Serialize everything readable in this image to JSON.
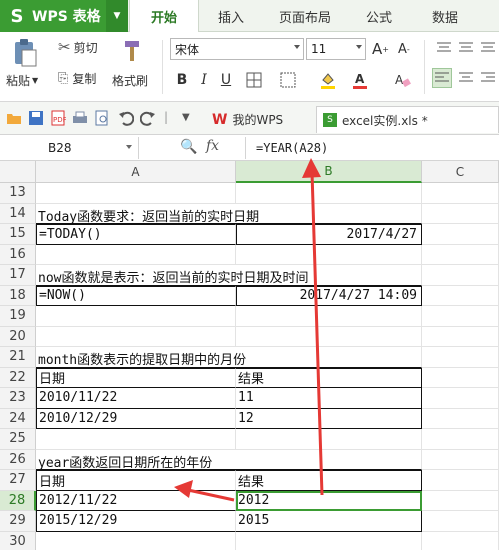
{
  "app": {
    "name": "WPS 表格",
    "logo": "S"
  },
  "ribbon_tabs": [
    "开始",
    "插入",
    "页面布局",
    "公式",
    "数据"
  ],
  "ribbon": {
    "paste": "粘贴",
    "cut": "剪切",
    "copy": "复制",
    "format_painter": "格式刷",
    "font_name": "宋体",
    "font_size": "11",
    "bold": "B",
    "italic": "I",
    "underline": "U",
    "grow_font": "A",
    "shrink_font": "A"
  },
  "doc_tabs": [
    {
      "label": "我的WPS",
      "icon": "wps-logo-icon"
    },
    {
      "label": "excel实例.xls *",
      "icon": "spreadsheet-file-icon"
    }
  ],
  "formula_bar": {
    "name_box": "B28",
    "fx": "fx",
    "formula": "=YEAR(A28)"
  },
  "columns": [
    "A",
    "B",
    "C"
  ],
  "rows": [
    {
      "n": "13",
      "a": "",
      "b": ""
    },
    {
      "n": "14",
      "a": "Today函数要求：返回当前的实时日期",
      "b": ""
    },
    {
      "n": "15",
      "a": "  =TODAY()",
      "b": "2017/4/27"
    },
    {
      "n": "16",
      "a": "",
      "b": ""
    },
    {
      "n": "17",
      "a": "now函数就是表示：返回当前的实时日期及时间",
      "b": ""
    },
    {
      "n": "18",
      "a": "  =NOW()",
      "b": "2017/4/27 14:09"
    },
    {
      "n": "19",
      "a": "",
      "b": ""
    },
    {
      "n": "20",
      "a": "",
      "b": ""
    },
    {
      "n": "21",
      "a": "month函数表示的提取日期中的月份",
      "b": ""
    },
    {
      "n": "22",
      "a": "日期",
      "b": "结果"
    },
    {
      "n": "23",
      "a": "2010/11/22",
      "b": "11"
    },
    {
      "n": "24",
      "a": "2010/12/29",
      "b": "12"
    },
    {
      "n": "25",
      "a": "",
      "b": ""
    },
    {
      "n": "26",
      "a": "year函数返回日期所在的年份",
      "b": ""
    },
    {
      "n": "27",
      "a": "日期",
      "b": "结果"
    },
    {
      "n": "28",
      "a": "2012/11/22",
      "b": "2012"
    },
    {
      "n": "29",
      "a": "2015/12/29",
      "b": "2015"
    },
    {
      "n": "30",
      "a": "",
      "b": ""
    }
  ],
  "colors": {
    "accent": "#3b9c33",
    "annotation_arrow": "#e53935"
  }
}
